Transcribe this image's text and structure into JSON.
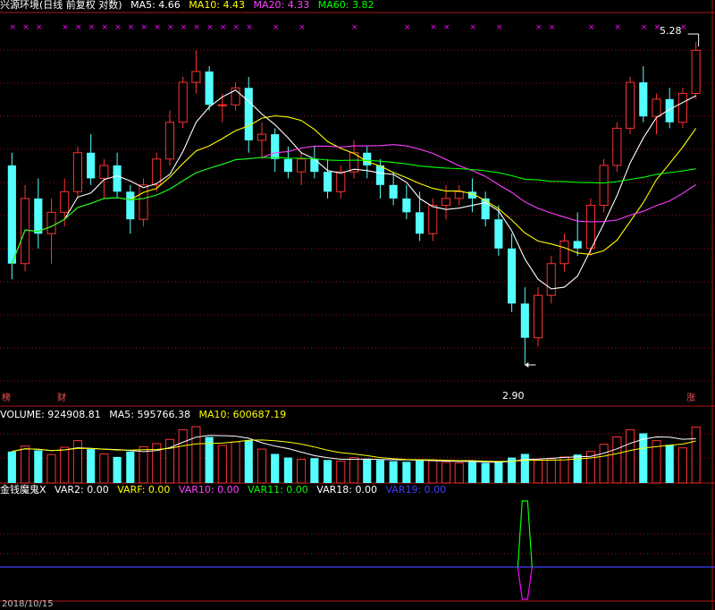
{
  "main_header": {
    "title": "兴源环境(日线 前复权 对数)",
    "ma5_label": "MA5: 4.66",
    "ma10_label": "MA10: 4.43",
    "ma20_label": "MA20: 4.33",
    "ma60_label": "MA60: 3.82"
  },
  "volume_header": {
    "volume_label": "VOLUME: 924908.81",
    "ma5_label": "MA5: 595766.38",
    "ma10_label": "MA10: 600687.19"
  },
  "indicator_header": {
    "name": "金钱魔鬼X",
    "var2_label": "VAR2: 0.00",
    "varf_label": "VARF: 0.00",
    "var10_label": "VAR10: 0.00",
    "var11_label": "VAR11: 0.00",
    "var18_label": "VAR18: 0.00",
    "var19_label": "VAR19: 0.00"
  },
  "annotations": {
    "high_price": "5.28",
    "low_price": "2.90",
    "tag_left": "榜",
    "tag_mid": "财",
    "tag_right": "涨",
    "date_fragment": "2018/10/15"
  },
  "colors": {
    "up": "#ff3232",
    "down": "#54ffff",
    "ma5": "#ffffff",
    "ma10": "#ffff00",
    "ma20": "#ff40ff",
    "ma60": "#00ff00",
    "signal": "#ff00ff",
    "var19": "#4040ff"
  },
  "chart_data": {
    "type": "candlestick",
    "scale": "log",
    "price_range": [
      2.9,
      5.28
    ],
    "candles_ohlc": [
      [
        4.2,
        4.3,
        3.4,
        3.5
      ],
      [
        3.5,
        4.05,
        3.45,
        3.95
      ],
      [
        3.95,
        4.1,
        3.6,
        3.7
      ],
      [
        3.7,
        3.95,
        3.5,
        3.85
      ],
      [
        3.85,
        4.1,
        3.75,
        4.0
      ],
      [
        4.0,
        4.35,
        3.95,
        4.3
      ],
      [
        4.3,
        4.45,
        4.05,
        4.1
      ],
      [
        4.1,
        4.25,
        3.95,
        4.2
      ],
      [
        4.2,
        4.3,
        3.95,
        4.0
      ],
      [
        4.0,
        4.05,
        3.7,
        3.8
      ],
      [
        3.8,
        4.1,
        3.75,
        4.05
      ],
      [
        4.05,
        4.3,
        4.0,
        4.25
      ],
      [
        4.25,
        4.65,
        4.2,
        4.55
      ],
      [
        4.55,
        4.95,
        4.5,
        4.9
      ],
      [
        4.9,
        5.2,
        4.8,
        5.0
      ],
      [
        5.0,
        5.05,
        4.65,
        4.7
      ],
      [
        4.7,
        4.8,
        4.55,
        4.7
      ],
      [
        4.7,
        4.9,
        4.65,
        4.85
      ],
      [
        4.85,
        4.95,
        4.3,
        4.4
      ],
      [
        4.4,
        4.55,
        4.25,
        4.45
      ],
      [
        4.45,
        4.5,
        4.15,
        4.25
      ],
      [
        4.25,
        4.35,
        4.1,
        4.15
      ],
      [
        4.15,
        4.3,
        4.05,
        4.25
      ],
      [
        4.25,
        4.35,
        4.1,
        4.15
      ],
      [
        4.15,
        4.25,
        3.95,
        4.0
      ],
      [
        4.0,
        4.2,
        3.95,
        4.15
      ],
      [
        4.15,
        4.4,
        4.1,
        4.3
      ],
      [
        4.3,
        4.35,
        4.1,
        4.2
      ],
      [
        4.2,
        4.25,
        3.95,
        4.05
      ],
      [
        4.05,
        4.15,
        3.9,
        3.95
      ],
      [
        3.95,
        4.05,
        3.8,
        3.85
      ],
      [
        3.85,
        4.0,
        3.65,
        3.7
      ],
      [
        3.7,
        3.95,
        3.65,
        3.9
      ],
      [
        3.9,
        4.05,
        3.8,
        3.95
      ],
      [
        3.95,
        4.05,
        3.9,
        4.0
      ],
      [
        4.0,
        4.1,
        3.85,
        3.95
      ],
      [
        3.95,
        4.0,
        3.75,
        3.8
      ],
      [
        3.8,
        3.9,
        3.55,
        3.6
      ],
      [
        3.6,
        3.7,
        3.2,
        3.25
      ],
      [
        3.25,
        3.35,
        2.9,
        3.05
      ],
      [
        3.05,
        3.35,
        3.0,
        3.3
      ],
      [
        3.3,
        3.55,
        3.25,
        3.5
      ],
      [
        3.5,
        3.7,
        3.45,
        3.65
      ],
      [
        3.65,
        3.85,
        3.55,
        3.6
      ],
      [
        3.6,
        3.95,
        3.55,
        3.9
      ],
      [
        3.9,
        4.25,
        3.85,
        4.2
      ],
      [
        4.2,
        4.55,
        4.15,
        4.5
      ],
      [
        4.5,
        4.95,
        4.45,
        4.9
      ],
      [
        4.9,
        5.05,
        4.55,
        4.6
      ],
      [
        4.6,
        4.8,
        4.45,
        4.75
      ],
      [
        4.75,
        4.85,
        4.5,
        4.55
      ],
      [
        4.55,
        4.85,
        4.5,
        4.8
      ],
      [
        4.8,
        5.28,
        4.75,
        5.2
      ]
    ],
    "ma_series": [
      {
        "name": "MA5",
        "last": 4.66
      },
      {
        "name": "MA10",
        "last": 4.43
      },
      {
        "name": "MA20",
        "last": 4.33
      },
      {
        "name": "MA60",
        "last": 3.82
      }
    ],
    "volume": [
      520000,
      610000,
      540000,
      470000,
      590000,
      700000,
      560000,
      480000,
      430000,
      520000,
      600000,
      650000,
      720000,
      880000,
      930000,
      760000,
      620000,
      680000,
      700000,
      560000,
      480000,
      420000,
      390000,
      410000,
      380000,
      360000,
      420000,
      400000,
      380000,
      360000,
      350000,
      390000,
      370000,
      340000,
      330000,
      350000,
      330000,
      360000,
      420000,
      480000,
      380000,
      400000,
      430000,
      470000,
      520000,
      640000,
      760000,
      880000,
      820000,
      700000,
      630000,
      580000,
      924908.81
    ],
    "volume_ma": [
      {
        "name": "MA5",
        "last": 595766.38
      },
      {
        "name": "MA10",
        "last": 600687.19
      }
    ]
  }
}
